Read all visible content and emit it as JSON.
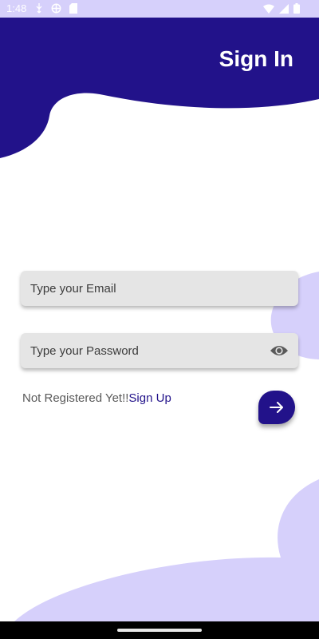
{
  "status_bar": {
    "time": "1:48",
    "left_icons": [
      "usb-icon",
      "vpn-icon",
      "sd-card-icon"
    ],
    "right_icons": [
      "wifi-icon",
      "signal-icon",
      "battery-icon"
    ]
  },
  "header": {
    "title": "Sign In"
  },
  "form": {
    "email_placeholder": "Type your Email",
    "password_placeholder": "Type your Password",
    "signup_prompt": "Not Registered Yet!!",
    "signup_link": "Sign Up",
    "submit_icon": "arrow-right-icon",
    "password_toggle_icon": "eye-icon"
  },
  "colors": {
    "primary": "#22128a",
    "accent_light": "#d6d0fb",
    "field_bg": "#e5e5e5",
    "background": "#ffffff"
  }
}
